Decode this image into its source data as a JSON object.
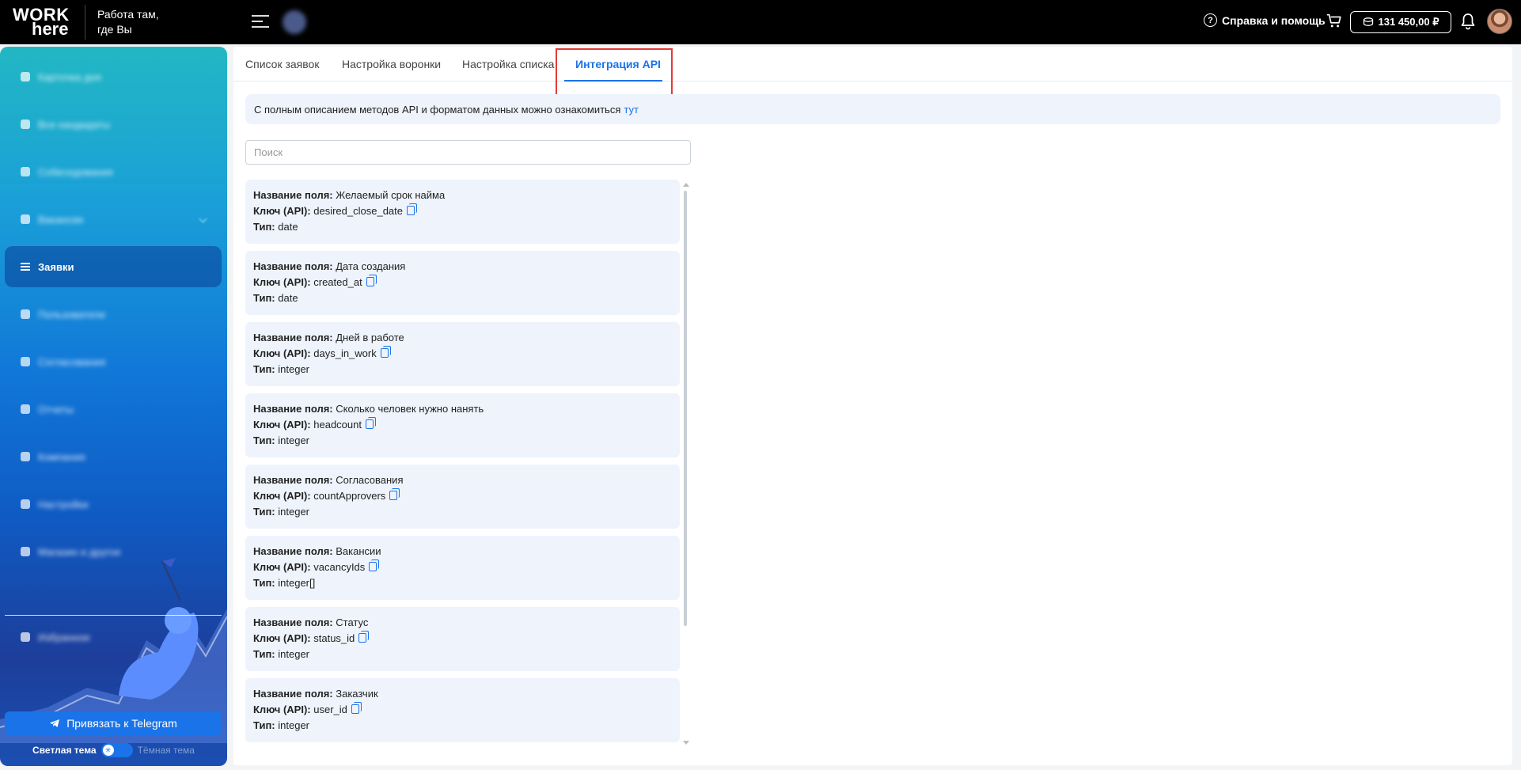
{
  "header": {
    "logo_line1": "WORK",
    "logo_line2": "here",
    "slogan_line1": "Работа там,",
    "slogan_line2": "где Вы",
    "help_label": "Справка и помощь",
    "balance": "131 450,00 ₽"
  },
  "sidebar": {
    "active_item": "Заявки",
    "telegram_button": "Привязать к Telegram",
    "theme_light": "Светлая тема",
    "theme_dark": "Тёмная тема"
  },
  "tabs": [
    {
      "label": "Список заявок"
    },
    {
      "label": "Настройка воронки"
    },
    {
      "label": "Настройка списка"
    },
    {
      "label": "Интеграция API"
    }
  ],
  "active_tab": "Интеграция API",
  "info": {
    "text": "С полным описанием методов API и форматом данных можно ознакомиться",
    "link": "тут"
  },
  "search": {
    "placeholder": "Поиск",
    "value": ""
  },
  "labels": {
    "name": "Название поля:",
    "key": "Ключ (API):",
    "type": "Тип:"
  },
  "fields": [
    {
      "name": "Желаемый срок найма",
      "key": "desired_close_date",
      "type": "date"
    },
    {
      "name": "Дата создания",
      "key": "created_at",
      "type": "date"
    },
    {
      "name": "Дней в работе",
      "key": "days_in_work",
      "type": "integer"
    },
    {
      "name": "Сколько человек нужно нанять",
      "key": "headcount",
      "type": "integer"
    },
    {
      "name": "Согласования",
      "key": "countApprovers",
      "type": "integer"
    },
    {
      "name": "Вакансии",
      "key": "vacancyIds",
      "type": "integer[]"
    },
    {
      "name": "Статус",
      "key": "status_id",
      "type": "integer"
    },
    {
      "name": "Заказчик",
      "key": "user_id",
      "type": "integer"
    }
  ],
  "colors": {
    "accent": "#1a73e8",
    "highlight_border": "#e53935",
    "card_bg": "#eef3fc"
  }
}
